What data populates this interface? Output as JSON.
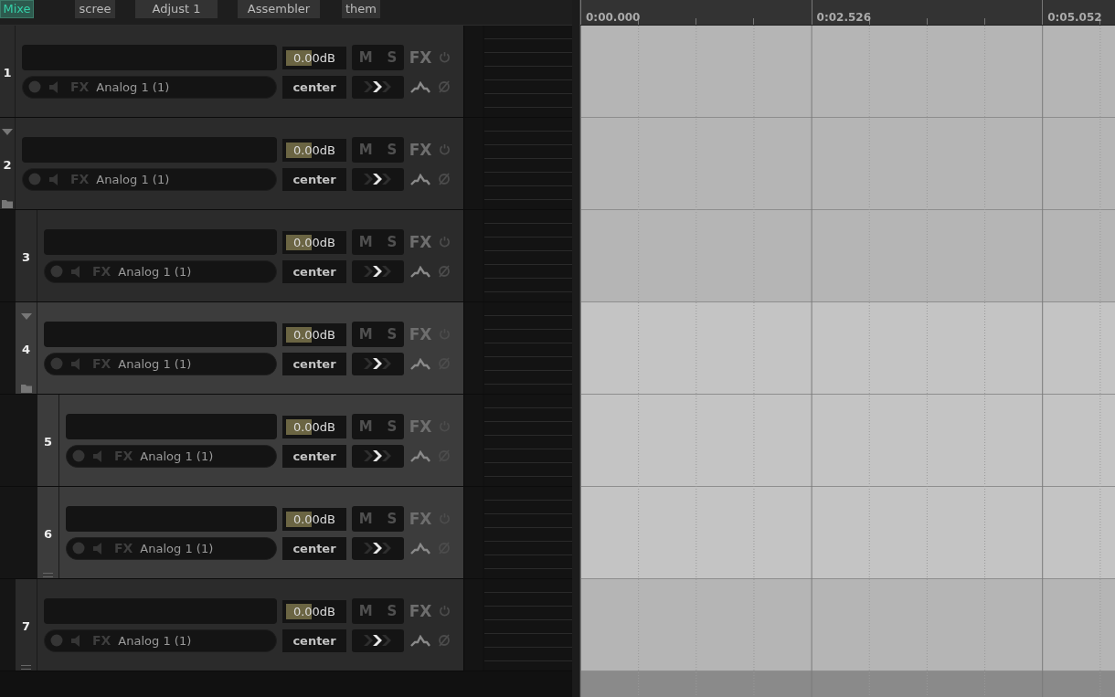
{
  "toolbar": {
    "buttons": [
      {
        "label": "Mixe",
        "selected": true
      },
      {
        "label": "scree",
        "selected": false
      },
      {
        "label": "Adjust 1",
        "selected": false
      },
      {
        "label": "Assembler",
        "selected": false
      },
      {
        "label": "them",
        "selected": false
      }
    ]
  },
  "ruler": {
    "times": [
      "0:00.000",
      "0:02.526",
      "0:05.052"
    ]
  },
  "tracks": [
    {
      "number": "1",
      "selected": false,
      "volume": {
        "reading": "0.00dB",
        "level": 0.45
      },
      "mute": "M",
      "solo": "S",
      "fx": "FX",
      "input_fx": "FX",
      "input": "Analog 1 (1)",
      "pan": "center"
    },
    {
      "number": "2",
      "selected": false,
      "expanded": true,
      "volume": {
        "reading": "0.00dB",
        "level": 0.45
      },
      "mute": "M",
      "solo": "S",
      "fx": "FX",
      "input_fx": "FX",
      "input": "Analog 1 (1)",
      "pan": "center",
      "children": [
        {
          "number": "3",
          "selected": false,
          "volume": {
            "reading": "0.00dB",
            "level": 0.45
          },
          "mute": "M",
          "solo": "S",
          "fx": "FX",
          "input_fx": "FX",
          "input": "Analog 1 (1)",
          "pan": "center"
        },
        {
          "number": "4",
          "selected": true,
          "expanded": true,
          "volume": {
            "reading": "0.00dB",
            "level": 0.45
          },
          "mute": "M",
          "solo": "S",
          "fx": "FX",
          "input_fx": "FX",
          "input": "Analog 1 (1)",
          "pan": "center",
          "children": [
            {
              "number": "5",
              "selected": true,
              "volume": {
                "reading": "0.00dB",
                "level": 0.45
              },
              "mute": "M",
              "solo": "S",
              "fx": "FX",
              "input_fx": "FX",
              "input": "Analog 1 (1)",
              "pan": "center"
            },
            {
              "number": "6",
              "selected": true,
              "volume": {
                "reading": "0.00dB",
                "level": 0.45
              },
              "mute": "M",
              "solo": "S",
              "fx": "FX",
              "input_fx": "FX",
              "input": "Analog 1 (1)",
              "pan": "center"
            }
          ]
        },
        {
          "number": "7",
          "selected": false,
          "volume": {
            "reading": "0.00dB",
            "level": 0.45
          },
          "mute": "M",
          "solo": "S",
          "fx": "FX",
          "input_fx": "FX",
          "input": "Analog 1 (1)",
          "pan": "center"
        }
      ]
    }
  ]
}
